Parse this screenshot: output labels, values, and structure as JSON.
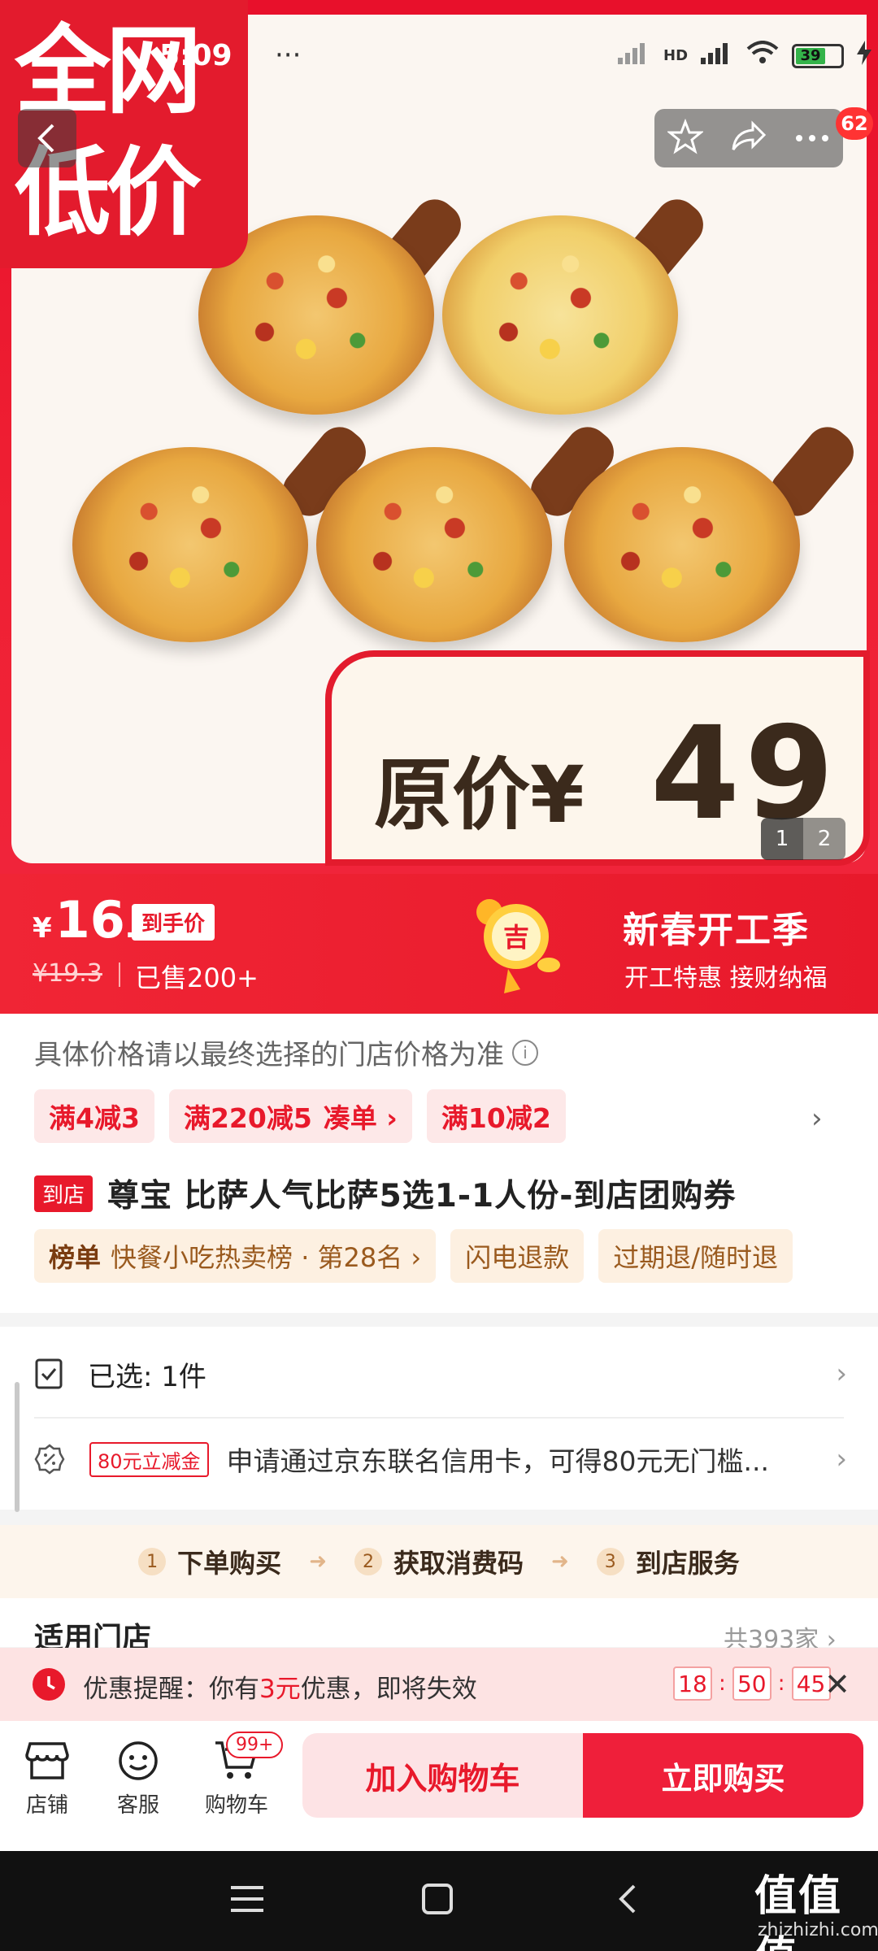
{
  "status_bar": {
    "time": "5:09",
    "dots": "···",
    "battery": "39",
    "network": "HD"
  },
  "hero": {
    "promo_line1": "全网",
    "promo_line2": "低价",
    "price_tag_label": "原价¥",
    "price_tag_value": "49",
    "pager": [
      "1",
      "2"
    ],
    "message_count": "62"
  },
  "price": {
    "symbol": "¥",
    "integer": "16",
    "decimal": ".3",
    "hand_price_label": "到手价",
    "original": "¥19.3",
    "sold": "已售200+"
  },
  "event": {
    "title": "新春开工季",
    "subtitle": "开工特惠 接财纳福",
    "lucky_char": "吉"
  },
  "notice": "具体价格请以最终选择的门店价格为准",
  "coupons": [
    {
      "label": "满4减3",
      "extra": ""
    },
    {
      "label": "满220减5",
      "extra": "凑单 ›"
    },
    {
      "label": "满10减2",
      "extra": ""
    }
  ],
  "product": {
    "store_tag": "到店",
    "title": "尊宝 比萨人气比萨5选1-1人份-到店团购券"
  },
  "tags": [
    {
      "prefix": "榜单",
      "label": "快餐小吃热卖榜 · 第28名 ›"
    },
    {
      "prefix": "",
      "label": "闪电退款"
    },
    {
      "prefix": "",
      "label": "过期退/随时退"
    }
  ],
  "selected": {
    "label": "已选: 1件"
  },
  "credit": {
    "tag": "80元立减金",
    "text": "申请通过京东联名信用卡，可得80元无门槛..."
  },
  "steps": [
    {
      "num": "1",
      "label": "下单购买"
    },
    {
      "num": "2",
      "label": "获取消费码"
    },
    {
      "num": "3",
      "label": "到店服务"
    }
  ],
  "stores": {
    "title": "适用门店",
    "count": "共393家 ›"
  },
  "reminder": {
    "prefix": "优惠提醒：你有",
    "highlight": "3元",
    "suffix": "优惠，即将失效",
    "timer": [
      "18",
      "50",
      "45"
    ]
  },
  "bottom": {
    "shop": "店铺",
    "service": "客服",
    "cart": "购物车",
    "cart_badge": "99+",
    "add_cart": "加入购物车",
    "buy_now": "立即购买"
  },
  "watermark": {
    "main": "值值值",
    "sub": "zhizhizhi.com"
  },
  "colors": {
    "brand_red": "#e8192b",
    "hero_bg": "#fbf6f1",
    "tag_bg": "#fdf0e1"
  }
}
